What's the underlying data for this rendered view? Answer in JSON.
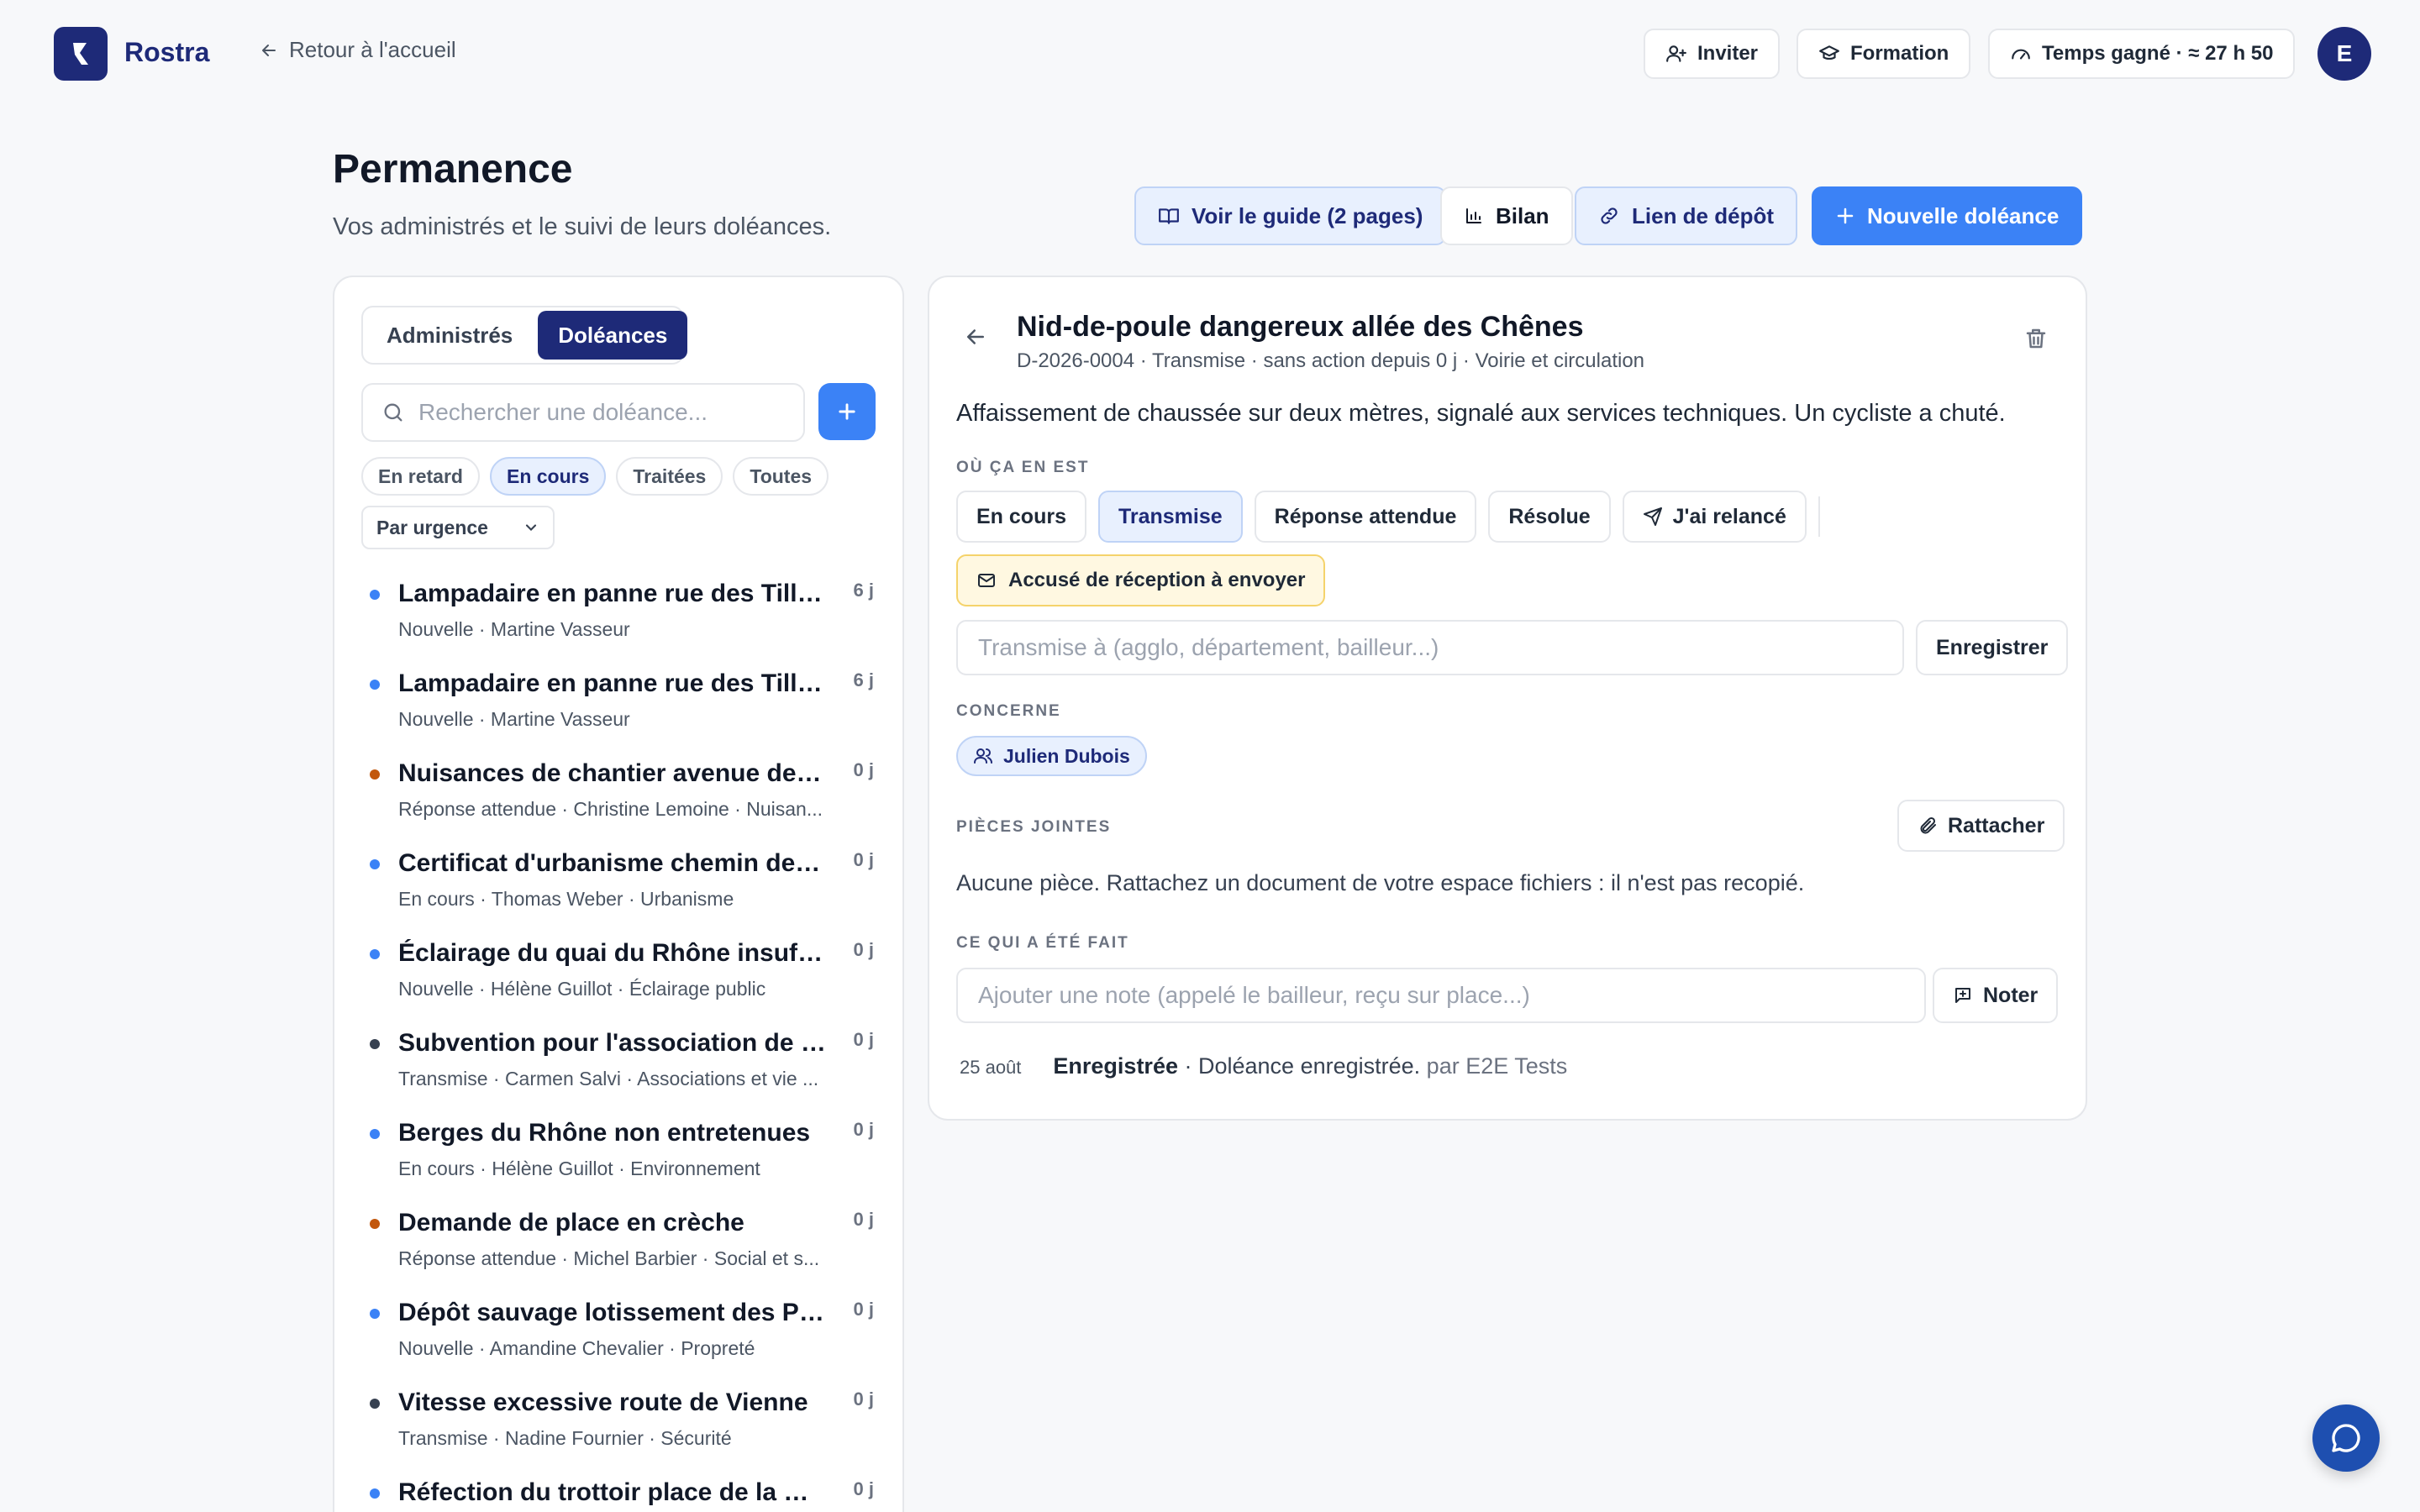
{
  "app": {
    "brand": "Rostra",
    "back_label": "Retour à l'accueil"
  },
  "topbar": {
    "invite": "Inviter",
    "formation": "Formation",
    "time_saved": "Temps gagné · ≈ 27 h 50",
    "avatar_initial": "E"
  },
  "page": {
    "title": "Permanence",
    "subtitle": "Vos administrés et le suivi de leurs doléances."
  },
  "actions": {
    "guide": "Voir le guide (2 pages)",
    "bilan": "Bilan",
    "link": "Lien de dépôt",
    "new": "Nouvelle doléance"
  },
  "left": {
    "tabs": [
      "Administrés",
      "Doléances"
    ],
    "active_tab": "Doléances",
    "search_placeholder": "Rechercher une doléance...",
    "filters": [
      "En retard",
      "En cours",
      "Traitées",
      "Toutes"
    ],
    "active_filter": "En cours",
    "sort": "Par urgence",
    "items": [
      {
        "title": "Lampadaire en panne rue des Tilleuls",
        "meta": "Nouvelle · Martine Vasseur",
        "age": "6 j",
        "dot": "#3b82f6"
      },
      {
        "title": "Lampadaire en panne rue des Tilleuls",
        "meta": "Nouvelle · Martine Vasseur",
        "age": "6 j",
        "dot": "#3b82f6"
      },
      {
        "title": "Nuisances de chantier avenue de la...",
        "meta": "Réponse attendue · Christine Lemoine · Nuisan...",
        "age": "0 j",
        "dot": "#c2570c"
      },
      {
        "title": "Certificat d'urbanisme chemin de H...",
        "meta": "En cours · Thomas Weber · Urbanisme",
        "age": "0 j",
        "dot": "#3b82f6"
      },
      {
        "title": "Éclairage du quai du Rhône insuffis...",
        "meta": "Nouvelle · Hélène Guillot · Éclairage public",
        "age": "0 j",
        "dot": "#3b82f6"
      },
      {
        "title": "Subvention pour l'association de q...",
        "meta": "Transmise · Carmen Salvi · Associations et vie ...",
        "age": "0 j",
        "dot": "#374151"
      },
      {
        "title": "Berges du Rhône non entretenues",
        "meta": "En cours · Hélène Guillot · Environnement",
        "age": "0 j",
        "dot": "#3b82f6"
      },
      {
        "title": "Demande de place en crèche",
        "meta": "Réponse attendue · Michel Barbier · Social et s...",
        "age": "0 j",
        "dot": "#c2570c"
      },
      {
        "title": "Dépôt sauvage lotissement des Prés",
        "meta": "Nouvelle · Amandine Chevalier · Propreté",
        "age": "0 j",
        "dot": "#3b82f6"
      },
      {
        "title": "Vitesse excessive route de Vienne",
        "meta": "Transmise · Nadine Fournier · Sécurité",
        "age": "0 j",
        "dot": "#374151"
      },
      {
        "title": "Réfection du trottoir place de la Ré...",
        "meta": "",
        "age": "0 j",
        "dot": "#3b82f6"
      }
    ]
  },
  "detail": {
    "title": "Nid-de-poule dangereux allée des Chênes",
    "meta": "D-2026-0004 · Transmise · sans action depuis 0 j · Voirie et circulation",
    "description": "Affaissement de chaussée sur deux mètres, signalé aux services techniques. Un cycliste a chuté.",
    "status_label": "OÙ ÇA EN EST",
    "statuses": [
      "En cours",
      "Transmise",
      "Réponse attendue",
      "Résolue"
    ],
    "active_status": "Transmise",
    "relance": "J'ai relancé",
    "accuse": "Accusé de réception à envoyer",
    "transmise_placeholder": "Transmise à (agglo, département, bailleur...)",
    "save": "Enregistrer",
    "concerne_label": "CONCERNE",
    "person": "Julien Dubois",
    "pieces_label": "PIÈCES JOINTES",
    "attach": "Rattacher",
    "no_pieces": "Aucune pièce. Rattachez un document de votre espace fichiers : il n'est pas recopié.",
    "done_label": "CE QUI A ÉTÉ FAIT",
    "note_placeholder": "Ajouter une note (appelé le bailleur, reçu sur place...)",
    "note_btn": "Noter",
    "log": {
      "date": "25 août",
      "event": "Enregistrée",
      "text": "· Doléance enregistrée.",
      "by": "par E2E Tests"
    }
  }
}
